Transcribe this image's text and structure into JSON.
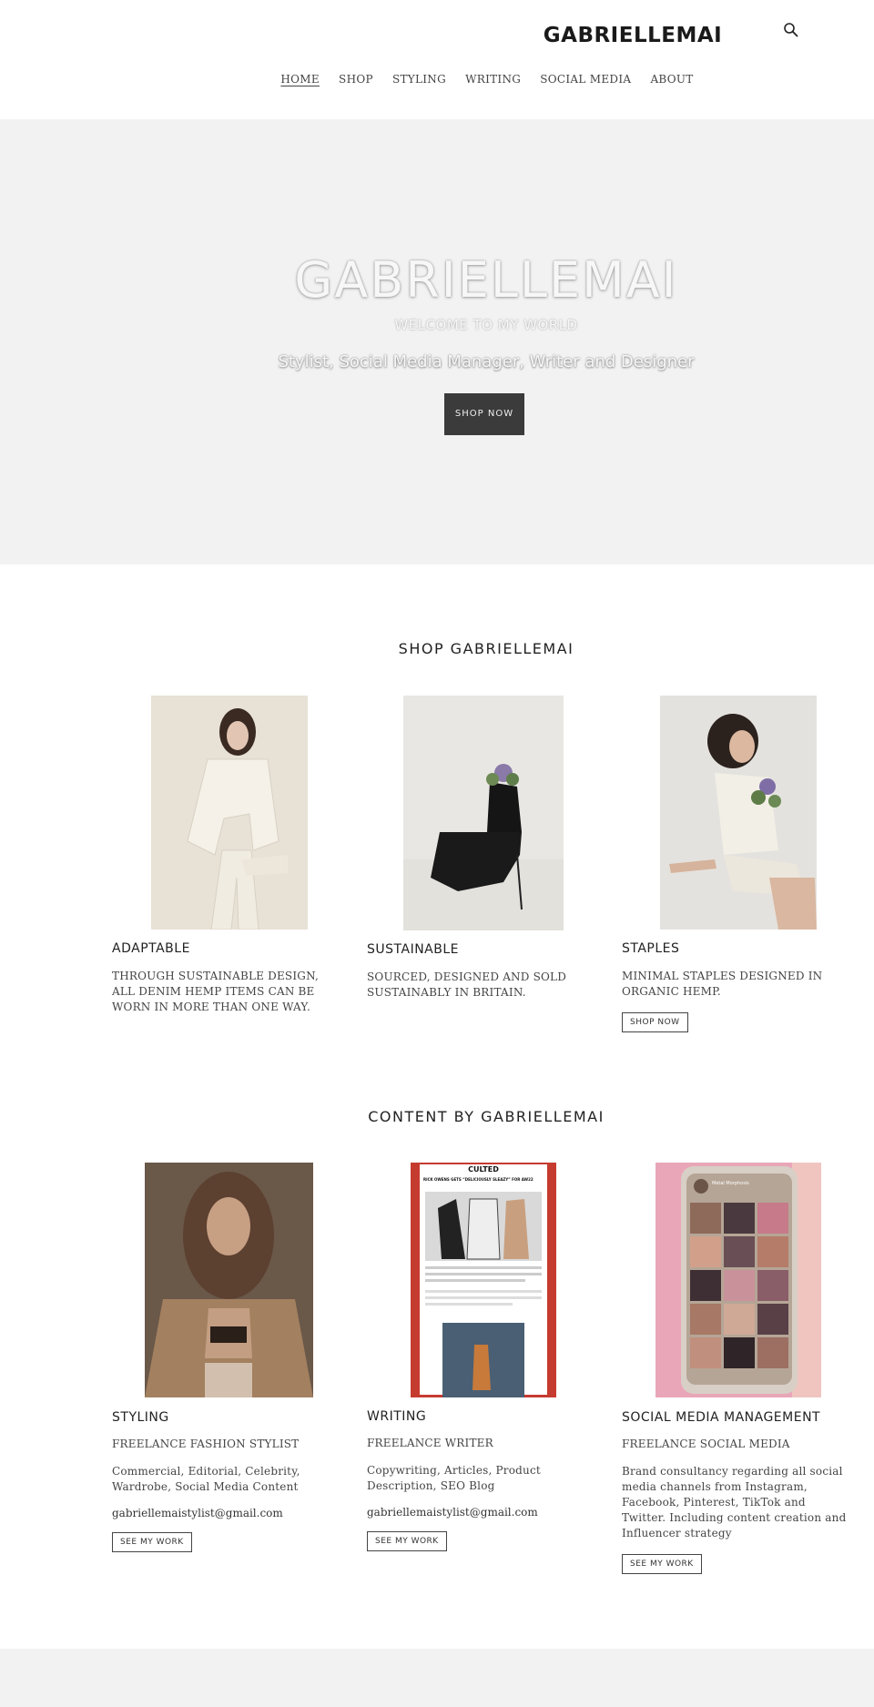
{
  "header": {
    "brand": "GABRIELLEMAI",
    "nav": [
      "HOME",
      "SHOP",
      "STYLING",
      "WRITING",
      "SOCIAL MEDIA",
      "ABOUT"
    ]
  },
  "hero": {
    "title": "GABRIELLEMAI",
    "kicker": "WELCOME TO MY WORLD",
    "subtitle": "Stylist, Social Media Manager, Writer and Designer",
    "button": "SHOP NOW"
  },
  "shop": {
    "heading": "SHOP GABRIELLEMAI",
    "items": [
      {
        "title": "ADAPTABLE",
        "text": "THROUGH SUSTAINABLE DESIGN, ALL DENIM HEMP ITEMS CAN BE WORN IN MORE THAN ONE WAY."
      },
      {
        "title": "SUSTAINABLE",
        "text": "SOURCED, DESIGNED AND SOLD SUSTAINABLY IN BRITAIN."
      },
      {
        "title": "STAPLES",
        "text": "MINIMAL STAPLES DESIGNED IN ORGANIC HEMP.",
        "button": "SHOP NOW"
      }
    ]
  },
  "content": {
    "heading": "CONTENT BY GABRIELLEMAI",
    "items": [
      {
        "title": "STYLING",
        "subtitle": "FREELANCE FASHION STYLIST",
        "text": "Commercial, Editorial, Celebrity, Wardrobe, Social Media Content",
        "email": "gabriellemaistylist@gmail.com",
        "button": "SEE MY WORK"
      },
      {
        "title": "WRITING",
        "subtitle": "FREELANCE WRITER",
        "text": "Copywriting, Articles, Product Description, SEO Blog",
        "email": "gabriellemaistylist@gmail.com",
        "button": "SEE MY WORK"
      },
      {
        "title": "SOCIAL MEDIA MANAGEMENT",
        "subtitle": "FREELANCE SOCIAL MEDIA",
        "text": "Brand consultancy regarding all social media channels from Instagram, Facebook, Pinterest, TikTok and Twitter. Including content creation and Influencer strategy",
        "button": "SEE MY WORK"
      }
    ]
  },
  "article": {
    "masthead": "CULTED",
    "headline": "RICK OWENS GETS “DELICIOUSLY SLEAZY” FOR AW22"
  },
  "phone": {
    "profile": "Metal Morphosis"
  },
  "colors": {
    "hero_bg": "#f2f2f2",
    "button_dark": "#3b3b3b",
    "text": "#333333"
  },
  "icons": [
    "search-icon"
  ]
}
